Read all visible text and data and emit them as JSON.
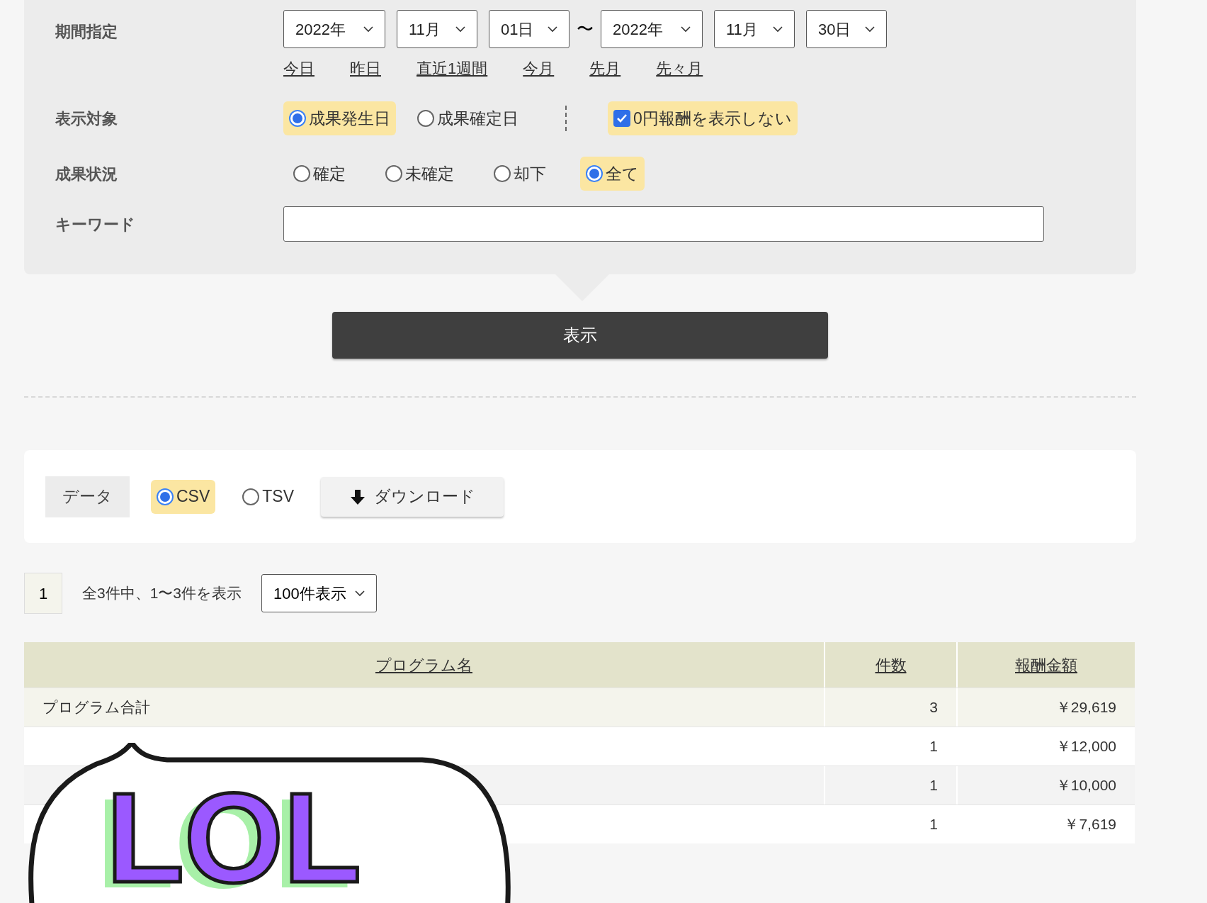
{
  "period": {
    "label": "期間指定",
    "start": [
      "2022年",
      "11月",
      "01日"
    ],
    "separator": "〜",
    "end": [
      "2022年",
      "11月",
      "30日"
    ],
    "shortcuts": [
      "今日",
      "昨日",
      "直近1週間",
      "今月",
      "先月",
      "先々月"
    ]
  },
  "display_target": {
    "label": "表示対象",
    "options": [
      {
        "label": "成果発生日",
        "selected": true
      },
      {
        "label": "成果確定日",
        "selected": false
      }
    ],
    "hide_zero": {
      "label": "0円報酬を表示しない",
      "checked": true
    }
  },
  "status": {
    "label": "成果状況",
    "options": [
      {
        "label": "確定",
        "selected": false
      },
      {
        "label": "未確定",
        "selected": false
      },
      {
        "label": "却下",
        "selected": false
      },
      {
        "label": "全て",
        "selected": true
      }
    ]
  },
  "keyword": {
    "label": "キーワード"
  },
  "submit": "表示",
  "export": {
    "label": "データ",
    "formats": [
      {
        "label": "CSV",
        "selected": true
      },
      {
        "label": "TSV",
        "selected": false
      }
    ],
    "download": "ダウンロード"
  },
  "pagination": {
    "page": "1",
    "summary": "全3件中、1〜3件を表示",
    "per_page": "100件表示"
  },
  "table": {
    "columns": [
      "プログラム名",
      "件数",
      "報酬金額"
    ],
    "rows": [
      {
        "kind": "total",
        "name": "プログラム合計",
        "count": "3",
        "amount": "￥29,619"
      },
      {
        "kind": "item",
        "count": "1",
        "amount": "￥12,000"
      },
      {
        "kind": "item",
        "count": "1",
        "amount": "￥10,000"
      },
      {
        "kind": "item",
        "count": "1",
        "amount": "￥7,619"
      }
    ]
  },
  "sticker": {
    "text": "LOL"
  }
}
